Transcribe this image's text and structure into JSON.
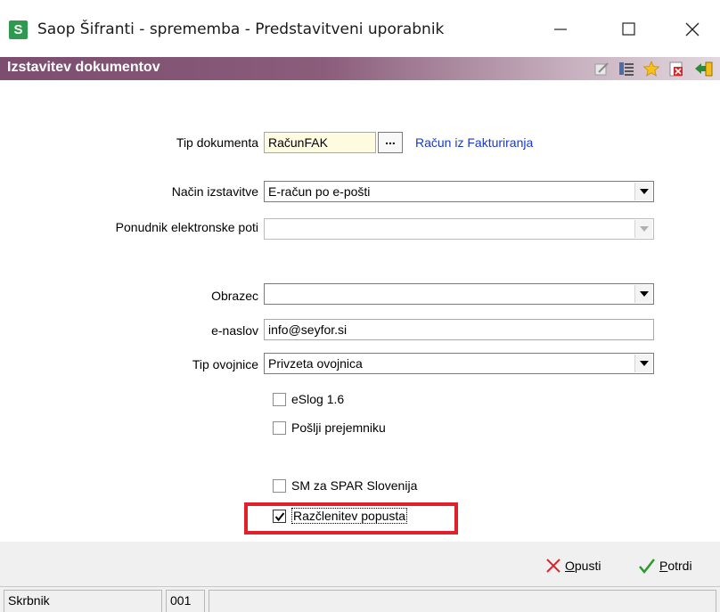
{
  "window": {
    "app_icon_letter": "S",
    "title": "Saop Šifranti - sprememba - Predstavitveni uporabnik"
  },
  "header": {
    "title": "Izstavitev dokumentov",
    "toolbar_icons": [
      "edit-icon",
      "list-icon",
      "star-icon",
      "delete-icon",
      "exit-icon"
    ]
  },
  "form": {
    "tip_dokumenta": {
      "label": "Tip dokumenta",
      "value": "RačunFAK",
      "browse_label": "...",
      "description": "Račun iz Fakturiranja"
    },
    "nacin_izstavitve": {
      "label": "Način izstavitve",
      "value": "E-račun po e-pošti"
    },
    "ponudnik": {
      "label": "Ponudnik elektronske poti",
      "value": ""
    },
    "obrazec": {
      "label": "Obrazec",
      "value": ""
    },
    "e_naslov": {
      "label": "e-naslov",
      "value": "info@seyfor.si"
    },
    "tip_ovojnice": {
      "label": "Tip ovojnice",
      "value": "Privzeta ovojnica"
    },
    "checkboxes": [
      {
        "label": "eSlog 1.6",
        "checked": false
      },
      {
        "label": "Pošlji prejemniku",
        "checked": false
      },
      {
        "label": "SM za SPAR Slovenija",
        "checked": false
      },
      {
        "label": "Razčlenitev popusta",
        "checked": true
      }
    ]
  },
  "actions": {
    "cancel": {
      "label_first": "O",
      "label_rest": "pusti"
    },
    "confirm": {
      "label_first": "P",
      "label_rest": "otrdi"
    }
  },
  "statusbar": {
    "user": "Skrbnik",
    "code": "001",
    "extra": ""
  },
  "colors": {
    "header_start": "#7b4d6f",
    "link": "#1a38c8",
    "highlight": "#e0202a",
    "app_icon": "#2e9a4f"
  }
}
